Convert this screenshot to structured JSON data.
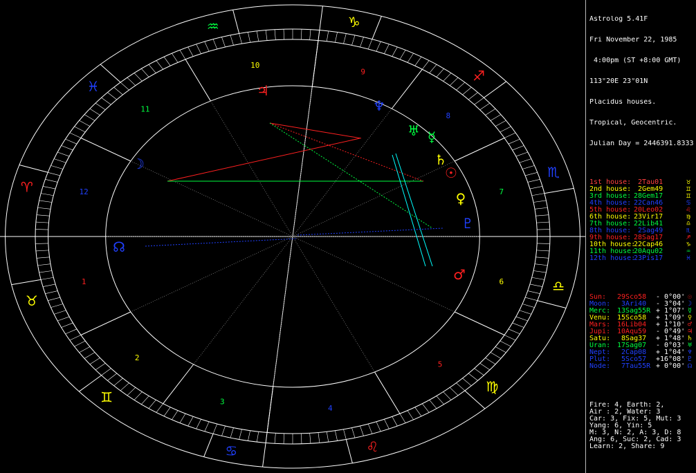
{
  "header": {
    "app_title": "Astrolog 5.41F",
    "date": "Fri November 22, 1985",
    "time": " 4:00pm (ST +8:00 GMT)",
    "location": "113°20E 23°01N",
    "house_system": "Placidus houses.",
    "zodiac": "Tropical, Geocentric.",
    "julian_day": "Julian Day = 2446391.8333"
  },
  "houses": [
    {
      "label": "1st house:",
      "value": "  2Tau01",
      "color": "#ff4040",
      "sign_glyph": "♉",
      "sign_color": "#ffff00"
    },
    {
      "label": "2nd house:",
      "value": "  2Gem49",
      "color": "#ffff00",
      "sign_glyph": "♊",
      "sign_color": "#ffff00"
    },
    {
      "label": "3rd house:",
      "value": " 28Gem17",
      "color": "#00ff40",
      "sign_glyph": "♊",
      "sign_color": "#ffff00"
    },
    {
      "label": "4th house:",
      "value": " 22Can46",
      "color": "#2040ff",
      "sign_glyph": "♋",
      "sign_color": "#2040ff"
    },
    {
      "label": "5th house:",
      "value": " 20Leo02",
      "color": "#ff2020",
      "sign_glyph": "♌",
      "sign_color": "#ff2020"
    },
    {
      "label": "6th house:",
      "value": " 23Vir17",
      "color": "#ffff00",
      "sign_glyph": "♍",
      "sign_color": "#ffff00"
    },
    {
      "label": "7th house:",
      "value": " 22Lib41",
      "color": "#00ff40",
      "sign_glyph": "♎",
      "sign_color": "#ffff00"
    },
    {
      "label": "8th house:",
      "value": "  2Sag49",
      "color": "#2040ff",
      "sign_glyph": "♏",
      "sign_color": "#2040ff"
    },
    {
      "label": "9th house:",
      "value": " 28Sag17",
      "color": "#ff2020",
      "sign_glyph": "♐",
      "sign_color": "#ff2020"
    },
    {
      "label": "10th house:",
      "value": " 22Cap46",
      "color": "#ffff00",
      "sign_glyph": "♑",
      "sign_color": "#ffff00"
    },
    {
      "label": "11th house:",
      "value": " 20Aqu02",
      "color": "#00ff40",
      "sign_glyph": "♒",
      "sign_color": "#00ff40"
    },
    {
      "label": "12th house:",
      "value": " 23Pis17",
      "color": "#2040ff",
      "sign_glyph": "♓",
      "sign_color": "#2040ff"
    }
  ],
  "planets": [
    {
      "label": "Sun:",
      "value": " 29Sco58",
      "lat": " - 0°00'",
      "color": "#ff2020",
      "glyph": "☉"
    },
    {
      "label": "Moon:",
      "value": "  3Ari40",
      "lat": " - 3°04'",
      "color": "#2040ff",
      "glyph": "☽"
    },
    {
      "label": "Merc:",
      "value": " 13Sag55R",
      "lat": " + 1°07'",
      "color": "#00ff40",
      "glyph": "☿"
    },
    {
      "label": "Venu:",
      "value": " 15Sco58",
      "lat": " + 1°09'",
      "color": "#ffff00",
      "glyph": "♀"
    },
    {
      "label": "Mars:",
      "value": " 16Lib04",
      "lat": " + 1°10'",
      "color": "#ff2020",
      "glyph": "♂"
    },
    {
      "label": "Jupi:",
      "value": " 10Aqu59",
      "lat": " - 0°49'",
      "color": "#ff2020",
      "glyph": "♃"
    },
    {
      "label": "Satu:",
      "value": "  8Sag37",
      "lat": " + 1°48'",
      "color": "#ffff00",
      "glyph": "♄"
    },
    {
      "label": "Uran:",
      "value": " 17Sag07",
      "lat": " - 0°03'",
      "color": "#00ff40",
      "glyph": "♅"
    },
    {
      "label": "Nept:",
      "value": "  2Cap08",
      "lat": " + 1°04'",
      "color": "#2040ff",
      "glyph": "♆"
    },
    {
      "label": "Plut:",
      "value": "  5Sco57",
      "lat": " +16°08'",
      "color": "#2040ff",
      "glyph": "♇"
    },
    {
      "label": "Node:",
      "value": "  7Tau55R",
      "lat": " + 0°00'",
      "color": "#2040ff",
      "glyph": "☊"
    }
  ],
  "stats": [
    "Fire: 4, Earth: 2,",
    "Air : 2, Water: 3",
    "Car: 3, Fix: 5, Mut: 3",
    "Yang: 6, Yin: 5",
    "M: 3, N: 2, A: 3, D: 8",
    "Ang: 6, Suc: 2, Cad: 3",
    "Learn: 2, Share: 9"
  ],
  "chart": {
    "house_numbers": [
      "1",
      "2",
      "3",
      "4",
      "5",
      "6",
      "7",
      "8",
      "9",
      "10",
      "11",
      "12"
    ],
    "colors": {
      "fire": "#ff2020",
      "earth": "#ffff00",
      "air": "#00ff40",
      "water": "#2040ff",
      "ring": "#ffffff",
      "grid": "#888888"
    }
  }
}
